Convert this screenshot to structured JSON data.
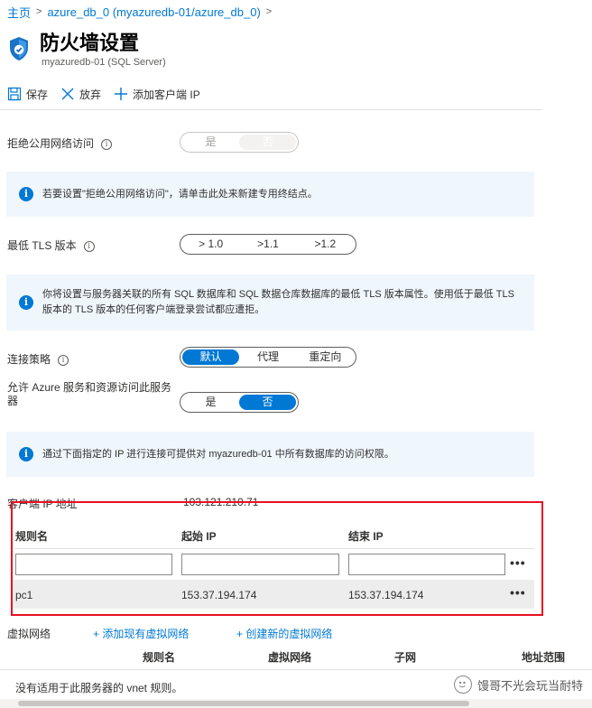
{
  "breadcrumb": {
    "items": [
      "主页",
      "azure_db_0 (myazuredb-01/azure_db_0)"
    ],
    "separator": ">"
  },
  "header": {
    "title": "防火墙设置",
    "subtitle": "myazuredb-01 (SQL Server)",
    "icon": "shield-icon"
  },
  "toolbar": {
    "save_label": "保存",
    "discard_label": "放弃",
    "add_ip_label": "添加客户端 IP"
  },
  "settings": {
    "deny_public": {
      "label": "拒绝公用网络访问",
      "options": [
        "是",
        "否"
      ],
      "selected": "否",
      "disabled": true
    },
    "deny_public_info": "若要设置\"拒绝公用网络访问\"，请单击此处来新建专用终结点。",
    "tls": {
      "label": "最低 TLS 版本",
      "options": [
        "> 1.0",
        ">1.1",
        ">1.2"
      ]
    },
    "tls_info": "你将设置与服务器关联的所有 SQL 数据库和 SQL 数据仓库数据库的最低 TLS 版本属性。使用低于最低 TLS 版本的 TLS 版本的任何客户端登录尝试都应遭拒。",
    "connection_policy": {
      "label": "连接策略",
      "options": [
        "默认",
        "代理",
        "重定向"
      ],
      "selected": "默认"
    },
    "allow_azure": {
      "label": "允许 Azure 服务和资源访问此服务器",
      "options": [
        "是",
        "否"
      ],
      "selected": "否"
    },
    "ip_info": "通过下面指定的 IP 进行连接可提供对 myazuredb-01 中所有数据库的访问权限。"
  },
  "client_ip": {
    "label": "客户端 IP 地址",
    "value": "103.121.210.71"
  },
  "rules_table": {
    "columns": [
      "规则名",
      "起始 IP",
      "结束 IP"
    ],
    "rows": [
      {
        "name": "pc1",
        "start_ip": "153.37.194.174",
        "end_ip": "153.37.194.174"
      }
    ],
    "more_label": "•••"
  },
  "vnet": {
    "label": "虚拟网络",
    "add_existing": "+ 添加现有虚拟网络",
    "create_new": "+ 创建新的虚拟网络",
    "columns": [
      "规则名",
      "虚拟网络",
      "子网",
      "地址范围"
    ],
    "empty_text": "没有适用于此服务器的 vnet 规则。"
  },
  "watermark": {
    "text": "馒哥不光会玩当耐特"
  },
  "colors": {
    "accent": "#0078d4",
    "info_bg": "#eff6fc",
    "highlight_border": "#e81123"
  }
}
